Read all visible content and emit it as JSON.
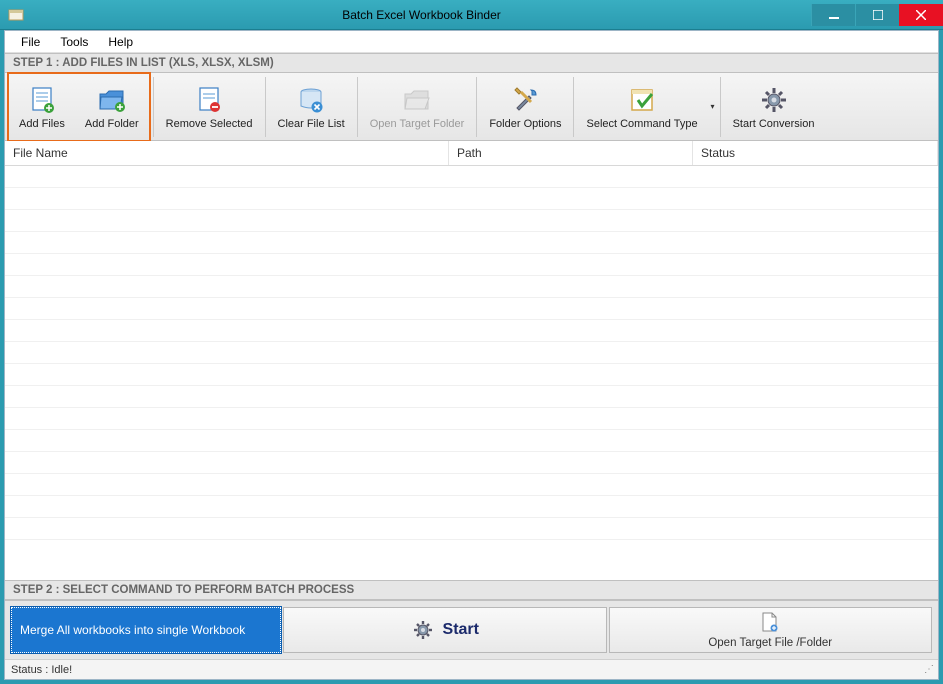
{
  "titlebar": {
    "title": "Batch Excel Workbook Binder"
  },
  "menu": {
    "file": "File",
    "tools": "Tools",
    "help": "Help"
  },
  "step1": {
    "header": "STEP 1 : ADD FILES IN LIST (XLS, XLSX, XLSM)"
  },
  "toolbar": {
    "add_files": "Add Files",
    "add_folder": "Add Folder",
    "remove_selected": "Remove Selected",
    "clear_file_list": "Clear File List",
    "open_target_folder": "Open Target Folder",
    "folder_options": "Folder Options",
    "select_command_type": "Select Command Type",
    "start_conversion": "Start Conversion"
  },
  "columns": {
    "filename": "File Name",
    "path": "Path",
    "status": "Status"
  },
  "step2": {
    "header": "STEP 2 : SELECT COMMAND TO PERFORM BATCH PROCESS",
    "selected_command": "Merge All workbooks into single Workbook",
    "start": "Start",
    "open_target": "Open Target File /Folder"
  },
  "statusbar": {
    "text": "Status  :  Idle!"
  }
}
